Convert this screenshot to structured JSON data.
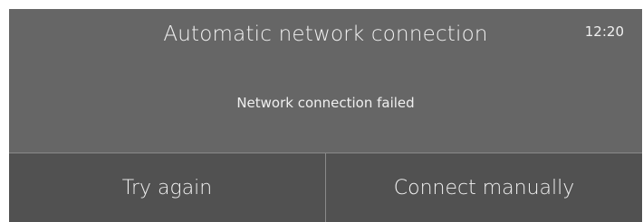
{
  "dialog": {
    "title": "Automatic network connection",
    "clock": "12:20",
    "message": "Network connection failed"
  },
  "actions": {
    "retry_label": "Try again",
    "manual_label": "Connect manually"
  },
  "colors": {
    "dialog_background": "#666666",
    "action_bar_background": "#515151",
    "divider": "#8a8a8a",
    "text": "#f2f2f2"
  }
}
